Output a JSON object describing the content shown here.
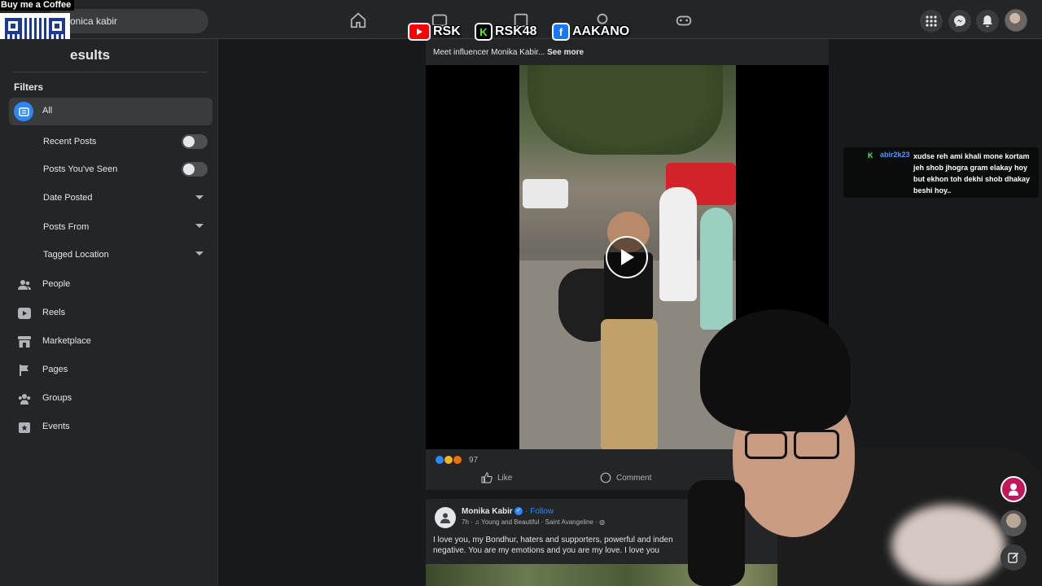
{
  "overlay": {
    "coffee_label": "Buy me a Coffee",
    "social": [
      {
        "platform": "youtube-icon",
        "label": "RSK",
        "color": "#ff0000"
      },
      {
        "platform": "kick-icon",
        "label": "RSK48",
        "color": "#53fc18"
      },
      {
        "platform": "facebook-icon",
        "label": "AAKANO",
        "color": "#1877f2"
      }
    ]
  },
  "topbar": {
    "search_value": "onica kabir"
  },
  "sidebar": {
    "results_title": "esults",
    "filters_label": "Filters",
    "all_label": "All",
    "toggles": [
      {
        "label": "Recent Posts",
        "on": false
      },
      {
        "label": "Posts You've Seen",
        "on": false
      }
    ],
    "dropdowns": [
      {
        "label": "Date Posted"
      },
      {
        "label": "Posts From"
      },
      {
        "label": "Tagged Location"
      }
    ],
    "categories": [
      {
        "label": "People",
        "icon": "people-icon"
      },
      {
        "label": "Reels",
        "icon": "reels-icon"
      },
      {
        "label": "Marketplace",
        "icon": "marketplace-icon"
      },
      {
        "label": "Pages",
        "icon": "flag-icon"
      },
      {
        "label": "Groups",
        "icon": "groups-icon"
      },
      {
        "label": "Events",
        "icon": "events-icon"
      }
    ]
  },
  "post1": {
    "caption": "Meet influencer Monika Kabir...",
    "see_more": "See more",
    "reaction_count": "97",
    "like_label": "Like",
    "comment_label": "Comment"
  },
  "post2": {
    "author": "Monika Kabir",
    "follow_label": "Follow",
    "meta": "7h · ♫ Young and Beautiful · Saint Avangeline · ◍",
    "text": "I love you, my Bondhur, haters and supporters, powerful and inden negative. You are my emotions and you are my love. I love you"
  },
  "chat": {
    "username": "abir2k23",
    "message": "xudse reh ami khali mone kortam jeh shob jhogra gram elakay hoy but ekhon toh dekhi shob dhakay beshi hoy.."
  },
  "colors": {
    "background": "#18191a",
    "surface": "#242526",
    "accent": "#2d88ff"
  }
}
